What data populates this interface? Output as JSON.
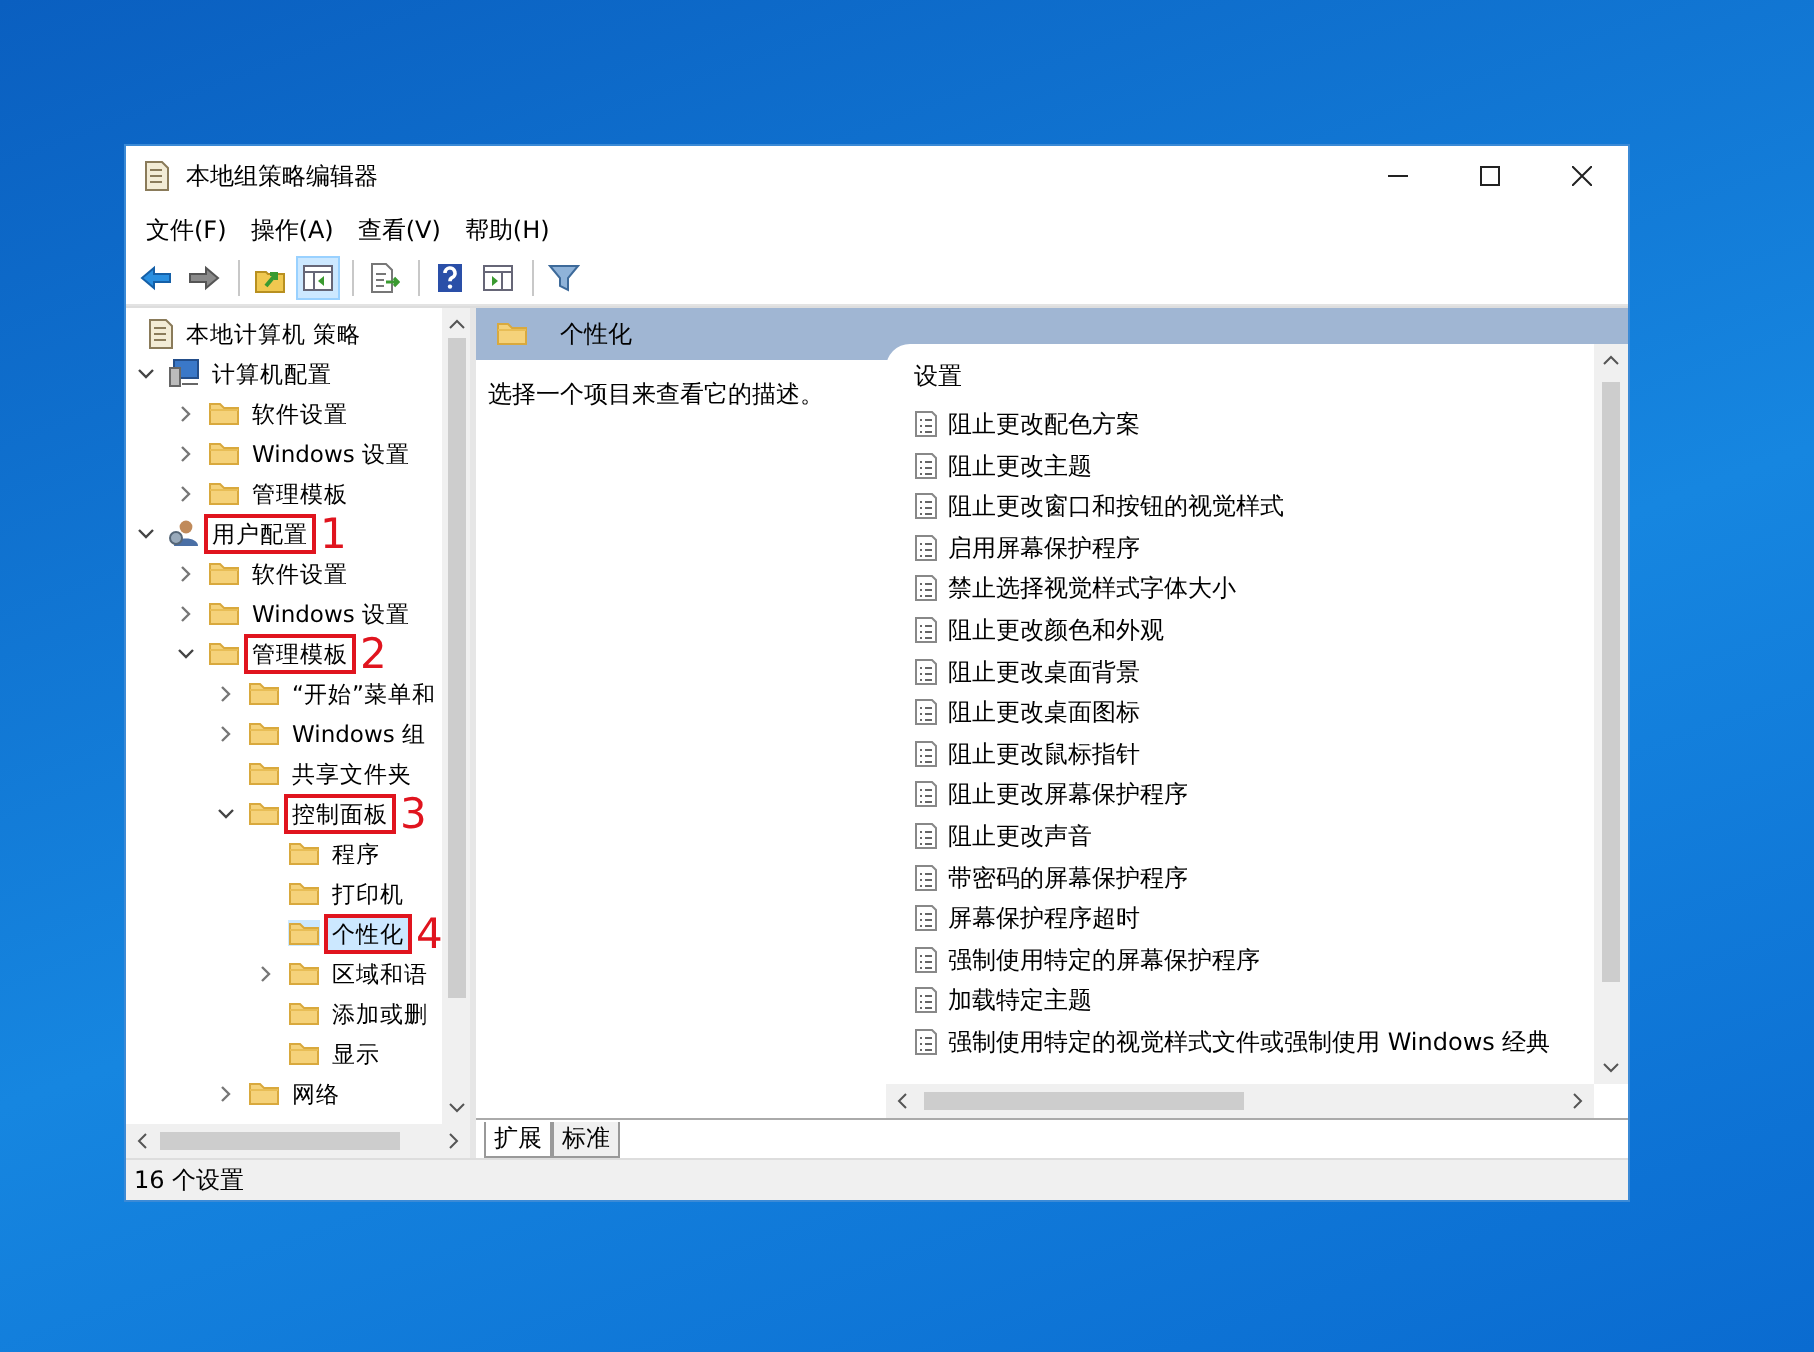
{
  "window": {
    "title": "本地组策略编辑器"
  },
  "menu": [
    "文件(F)",
    "操作(A)",
    "查看(V)",
    "帮助(H)"
  ],
  "toolbar": [
    {
      "kind": "back",
      "pressed": false
    },
    {
      "kind": "forward",
      "pressed": false
    },
    {
      "kind": "separator"
    },
    {
      "kind": "up",
      "pressed": false
    },
    {
      "kind": "tree",
      "pressed": true
    },
    {
      "kind": "separator"
    },
    {
      "kind": "export",
      "pressed": false
    },
    {
      "kind": "separator"
    },
    {
      "kind": "help",
      "pressed": false
    },
    {
      "kind": "pane",
      "pressed": false
    },
    {
      "kind": "separator"
    },
    {
      "kind": "filter",
      "pressed": false
    }
  ],
  "tree": [
    {
      "label": "本地计算机 策略",
      "kind": "policy",
      "selected": false,
      "children": [
        {
          "label": "计算机配置",
          "kind": "computer",
          "expanded": true,
          "selected": false,
          "children": [
            {
              "label": "软件设置",
              "kind": "folder",
              "expanded": false,
              "selected": false
            },
            {
              "label": "Windows 设置",
              "kind": "folder",
              "expanded": false,
              "selected": false
            },
            {
              "label": "管理模板",
              "kind": "folder",
              "expanded": false,
              "selected": false
            }
          ]
        },
        {
          "label": "用户配置",
          "kind": "user",
          "expanded": true,
          "selected": false,
          "annotation": "1",
          "children": [
            {
              "label": "软件设置",
              "kind": "folder",
              "expanded": false,
              "selected": false
            },
            {
              "label": "Windows 设置",
              "kind": "folder",
              "expanded": false,
              "selected": false
            },
            {
              "label": "管理模板",
              "kind": "folder",
              "expanded": true,
              "selected": false,
              "annotation": "2",
              "children": [
                {
                  "label": "“开始”菜单和",
                  "kind": "folder",
                  "expanded": false,
                  "selected": false
                },
                {
                  "label": "Windows 组",
                  "kind": "folder",
                  "expanded": false,
                  "selected": false
                },
                {
                  "label": "共享文件夹",
                  "kind": "folder",
                  "selected": false
                },
                {
                  "label": "控制面板",
                  "kind": "folder",
                  "expanded": true,
                  "selected": false,
                  "annotation": "3",
                  "children": [
                    {
                      "label": "程序",
                      "kind": "folder",
                      "selected": false
                    },
                    {
                      "label": "打印机",
                      "kind": "folder",
                      "selected": false
                    },
                    {
                      "label": "个性化",
                      "kind": "folder",
                      "selected": true,
                      "annotation": "4"
                    },
                    {
                      "label": "区域和语",
                      "kind": "folder",
                      "expanded": false,
                      "selected": false
                    },
                    {
                      "label": "添加或删",
                      "kind": "folder",
                      "selected": false
                    },
                    {
                      "label": "显示",
                      "kind": "folder",
                      "selected": false
                    }
                  ]
                },
                {
                  "label": "网络",
                  "kind": "folder",
                  "expanded": false,
                  "selected": false
                }
              ]
            }
          ]
        }
      ]
    }
  ],
  "details": {
    "title": "个性化",
    "description": "选择一个项目来查看它的描述。",
    "column": "设置",
    "settings": [
      "阻止更改配色方案",
      "阻止更改主题",
      "阻止更改窗口和按钮的视觉样式",
      "启用屏幕保护程序",
      "禁止选择视觉样式字体大小",
      "阻止更改颜色和外观",
      "阻止更改桌面背景",
      "阻止更改桌面图标",
      "阻止更改鼠标指针",
      "阻止更改屏幕保护程序",
      "阻止更改声音",
      "带密码的屏幕保护程序",
      "屏幕保护程序超时",
      "强制使用特定的屏幕保护程序",
      "加载特定主题",
      "强制使用特定的视觉样式文件或强制使用 Windows 经典"
    ]
  },
  "tabs": [
    {
      "label": "扩展",
      "selected": true
    },
    {
      "label": "标准",
      "selected": false
    }
  ],
  "status_bar": "16 个设置"
}
